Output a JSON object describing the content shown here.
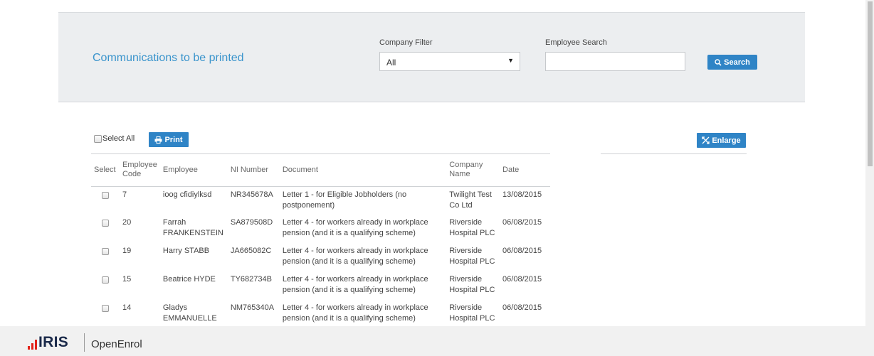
{
  "header": {
    "title": "Communications to be printed",
    "company_filter_label": "Company Filter",
    "company_filter_value": "All",
    "employee_search_label": "Employee Search",
    "employee_search_value": "",
    "search_button_label": "Search"
  },
  "toolbar": {
    "select_all_label": "Select All",
    "print_label": "Print",
    "enlarge_label": "Enlarge"
  },
  "table": {
    "columns": [
      "Select",
      "Employee Code",
      "Employee",
      "NI Number",
      "Document",
      "Company Name",
      "Date"
    ],
    "rows": [
      {
        "code": "7",
        "employee": "ioog cfidiylksd",
        "ni": "NR345678A",
        "document": "Letter 1 - for Eligible Jobholders (no postponement)",
        "company": "Twilight Test Co Ltd",
        "date": "13/08/2015"
      },
      {
        "code": "20",
        "employee": "Farrah FRANKENSTEIN",
        "ni": "SA879508D",
        "document": "Letter 4 - for workers already in workplace pension (and it is a qualifying scheme)",
        "company": "Riverside Hospital PLC",
        "date": "06/08/2015"
      },
      {
        "code": "19",
        "employee": "Harry STABB",
        "ni": "JA665082C",
        "document": "Letter 4 - for workers already in workplace pension (and it is a qualifying scheme)",
        "company": "Riverside Hospital PLC",
        "date": "06/08/2015"
      },
      {
        "code": "15",
        "employee": "Beatrice HYDE",
        "ni": "TY682734B",
        "document": "Letter 4 - for workers already in workplace pension (and it is a qualifying scheme)",
        "company": "Riverside Hospital PLC",
        "date": "06/08/2015"
      },
      {
        "code": "14",
        "employee": "Gladys EMMANUELLE",
        "ni": "NM765340A",
        "document": "Letter 4 - for workers already in workplace pension (and it is a qualifying scheme)",
        "company": "Riverside Hospital PLC",
        "date": "06/08/2015"
      }
    ]
  },
  "footer": {
    "logo_text": "IRIS",
    "product_name": "OpenEnrol"
  },
  "icons": {
    "search": "search-icon",
    "print": "printer-icon",
    "enlarge": "expand-icon",
    "dropdown": "caret-down-icon"
  },
  "colors": {
    "accent": "#2f84c6",
    "title": "#3a94cc",
    "logo_red": "#e2231a",
    "logo_navy": "#1b2a4a"
  }
}
